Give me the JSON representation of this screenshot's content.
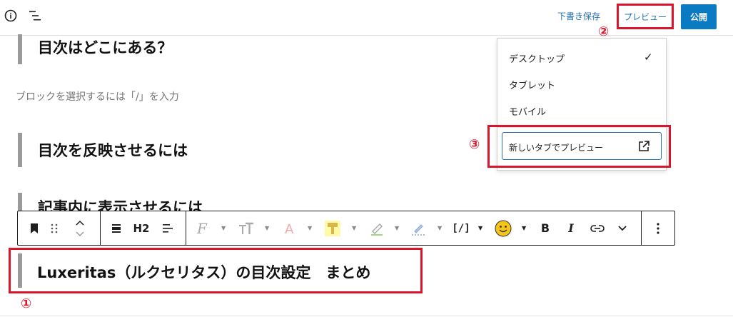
{
  "header": {
    "save_draft": "下書き保存",
    "preview": "プレビュー",
    "publish": "公開"
  },
  "content": {
    "heading1": "目次はどこにある？",
    "placeholder": "ブロックを選択するには「/」を入力",
    "heading2": "目次を反映させるには",
    "heading3": "記事内に表示させるには",
    "heading4": "Luxeritas（ルクセリタス）の目次設定　まとめ"
  },
  "toolbar": {
    "heading_level": "H2",
    "shortcode": "[/]",
    "bold": "B",
    "italic": "I"
  },
  "preview_menu": {
    "desktop": "デスクトップ",
    "tablet": "タブレット",
    "mobile": "モバイル",
    "check": "✓",
    "new_tab": "新しいタブでプレビュー"
  },
  "annotations": {
    "one": "①",
    "two": "②",
    "three": "③"
  },
  "colors": {
    "accent": "#2271b1",
    "publish": "#0a7ac2",
    "highlight": "#d9162c"
  }
}
